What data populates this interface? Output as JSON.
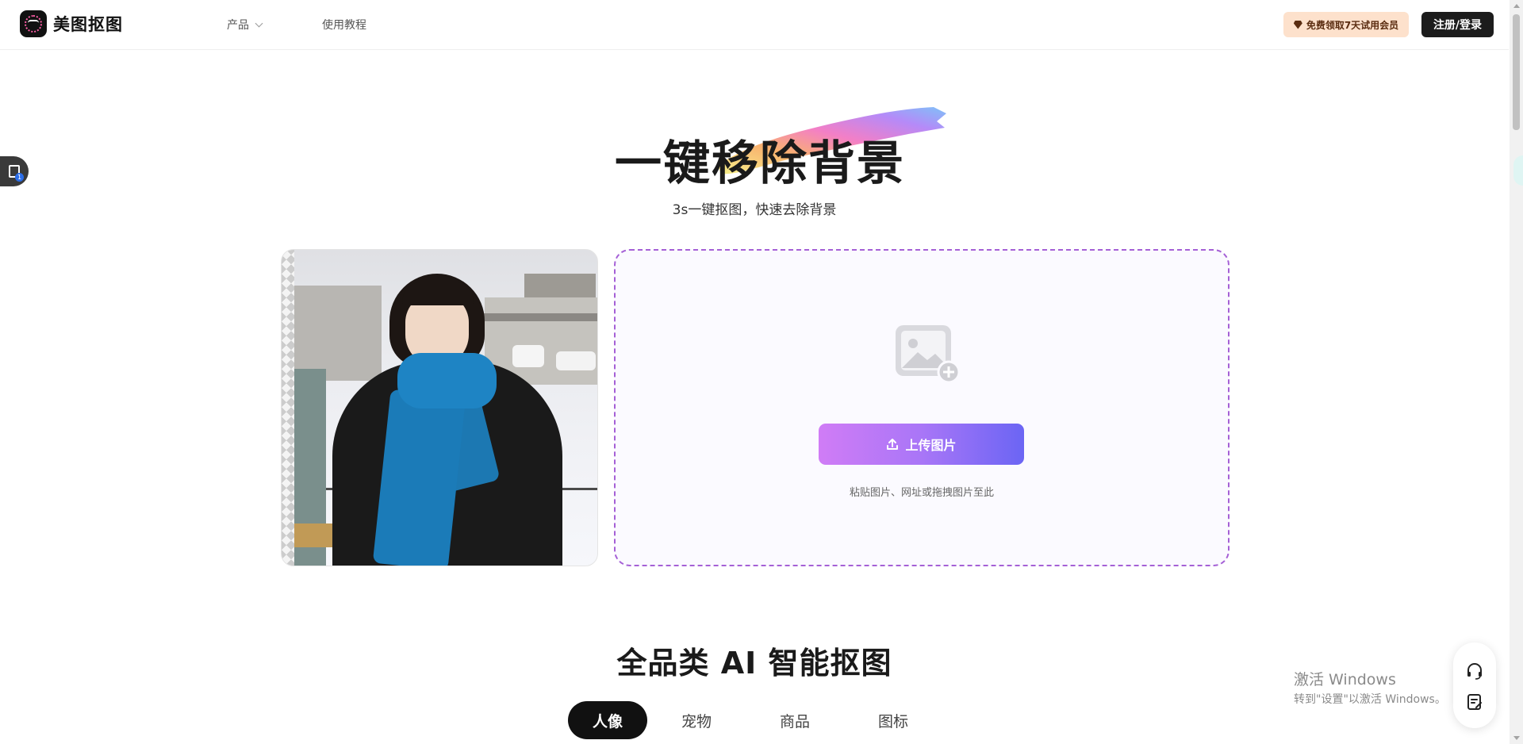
{
  "header": {
    "logo_text": "美图抠图",
    "nav": [
      {
        "label": "产品"
      },
      {
        "label": "使用教程"
      }
    ],
    "vip_label": "免费领取7天试用会员",
    "login_label": "注册/登录"
  },
  "hero": {
    "title": "一键移除背景",
    "subtitle": "3s一键抠图，快速去除背景"
  },
  "upload": {
    "button_label": "上传图片",
    "hint": "粘贴图片、网址或拖拽图片至此"
  },
  "section": {
    "title": "全品类 AI 智能抠图",
    "tabs": [
      {
        "label": "人像",
        "active": true
      },
      {
        "label": "宠物",
        "active": false
      },
      {
        "label": "商品",
        "active": false
      },
      {
        "label": "图标",
        "active": false
      }
    ]
  },
  "float_widget": {
    "badge": "1"
  },
  "watermark": {
    "line1": "激活 Windows",
    "line2": "转到\"设置\"以激活 Windows。"
  },
  "colors": {
    "accent_gradient_start": "#d07cf6",
    "accent_gradient_end": "#6b65f4",
    "upload_border": "#a560d6",
    "vip_bg": "#fde1cc",
    "dark": "#1c1c1c"
  }
}
